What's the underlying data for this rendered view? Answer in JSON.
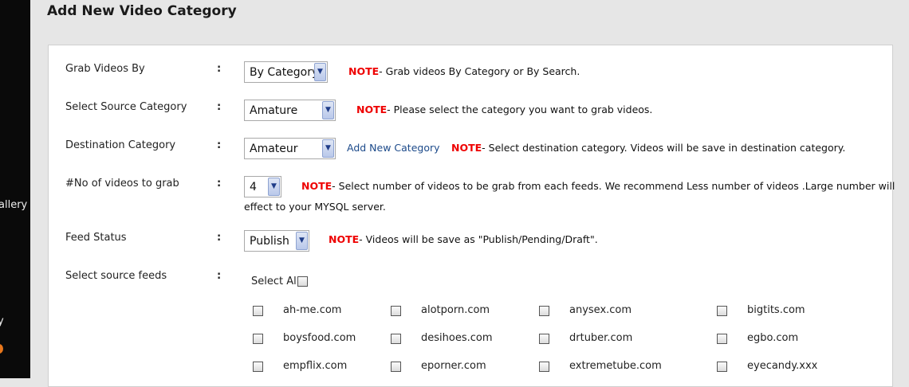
{
  "sidebar": {
    "frag1": "allery",
    "frag2": "y"
  },
  "page_title": "Add New Video Category",
  "form": {
    "colon": ":",
    "grab_by": {
      "label": "Grab Videos By",
      "value": "By Category",
      "note_tag": "NOTE",
      "note_text": "- Grab videos By Category or By Search."
    },
    "source_category": {
      "label": "Select Source Category",
      "value": "Amature",
      "note_tag": "NOTE",
      "note_text": "- Please select the category you want to grab videos."
    },
    "destination_category": {
      "label": "Destination Category",
      "value": "Amateur",
      "link": "Add New Category",
      "note_tag": "NOTE",
      "note_text": "- Select destination category. Videos will be save in destination category."
    },
    "num_videos": {
      "label": "#No of videos to grab",
      "value": "4",
      "note_tag": "NOTE",
      "note_text": "- Select number of videos to be grab from each feeds. We recommend Less number of videos .Large number will",
      "note_text2": "effect to your MYSQL server."
    },
    "feed_status": {
      "label": "Feed Status",
      "value": "Publish",
      "note_tag": "NOTE",
      "note_text": "- Videos will be save as \"Publish/Pending/Draft\"."
    },
    "source_feeds": {
      "label": "Select source feeds",
      "select_all": "Select All",
      "feeds": [
        [
          "ah-me.com",
          "alotporn.com",
          "anysex.com",
          "bigtits.com"
        ],
        [
          "boysfood.com",
          "desihoes.com",
          "drtuber.com",
          "egbo.com"
        ],
        [
          "empflix.com",
          "eporner.com",
          "extremetube.com",
          "eyecandy.xxx"
        ]
      ]
    }
  },
  "colors": {
    "note_red": "#e00000",
    "link_blue": "#1c4a8a",
    "page_bg": "#e6e6e6"
  }
}
